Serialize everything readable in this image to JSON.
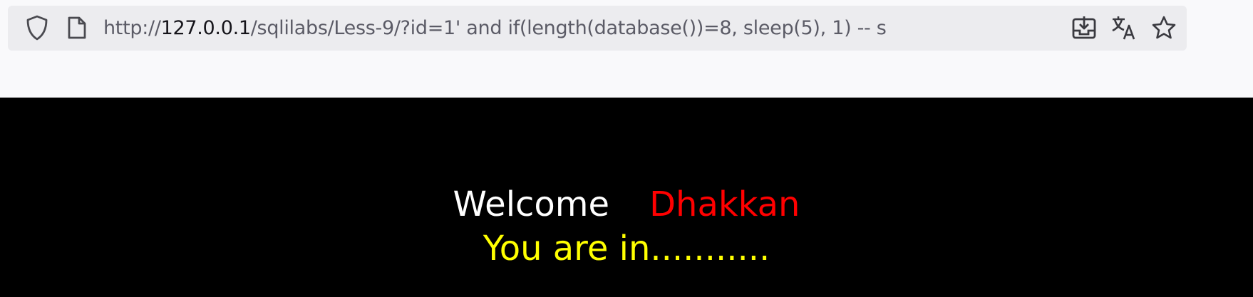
{
  "browser": {
    "url_scheme": "http://",
    "url_host": "127.0.0.1",
    "url_path": "/sqlilabs/Less-9/?id=1' and if(length(database())=8, sleep(5), 1) -- s",
    "icons": {
      "left": [
        "shield-icon",
        "page-icon"
      ],
      "right": [
        "save-to-pocket-icon",
        "translate-icon",
        "bookmark-star-icon"
      ]
    }
  },
  "page": {
    "welcome_text": "Welcome",
    "user_name": "Dhakkan",
    "status_text": "You are in...........",
    "colors": {
      "background": "#000000",
      "welcome": "#ffffff",
      "name": "#ff0000",
      "status": "#ffff00"
    }
  }
}
